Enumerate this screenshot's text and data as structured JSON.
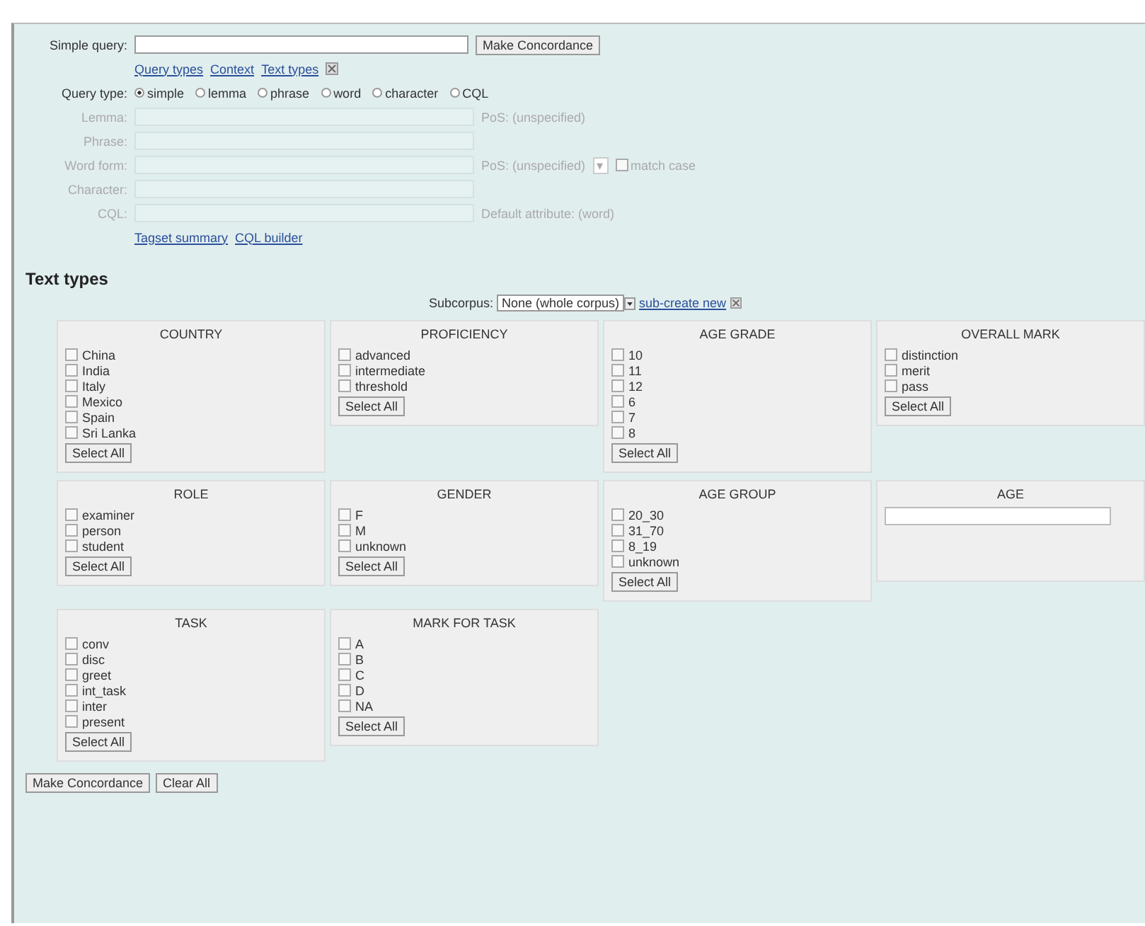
{
  "query": {
    "label": "Simple query:",
    "button": "Make Concordance"
  },
  "links": [
    "Query types",
    "Context",
    "Text types"
  ],
  "query_type": {
    "label": "Query type:",
    "options": [
      {
        "label": "simple",
        "selected": true
      },
      {
        "label": "lemma",
        "selected": false
      },
      {
        "label": "phrase",
        "selected": false
      },
      {
        "label": "word",
        "selected": false
      },
      {
        "label": "character",
        "selected": false
      },
      {
        "label": "CQL",
        "selected": false
      }
    ]
  },
  "fields": [
    {
      "label": "Lemma:",
      "extra": "PoS: (unspecified)"
    },
    {
      "label": "Phrase:"
    },
    {
      "label": "Word form:",
      "extra": "PoS: (unspecified)",
      "select_value": "▾",
      "checkbox": {
        "label": "match case",
        "checked": false
      }
    },
    {
      "label": "Character:"
    },
    {
      "label": "CQL:",
      "extra": "Default attribute: (word)"
    }
  ],
  "tool_links": [
    "Tagset summary",
    "CQL builder"
  ],
  "text_types": {
    "title": "Text types",
    "subcorpus_label": "Subcorpus:",
    "subcorpus_value": "None (whole corpus)",
    "subcorpus_link": "sub-create new",
    "boxes": [
      {
        "kind": "list",
        "title": "COUNTRY",
        "items": [
          {
            "label": "China",
            "checked": false
          },
          {
            "label": "India",
            "checked": false
          },
          {
            "label": "Italy",
            "checked": false
          },
          {
            "label": "Mexico",
            "checked": false
          },
          {
            "label": "Spain",
            "checked": false
          },
          {
            "label": "Sri Lanka",
            "checked": false
          }
        ],
        "button": "Select All"
      },
      {
        "kind": "list",
        "title": "PROFICIENCY",
        "items": [
          {
            "label": "advanced",
            "checked": false
          },
          {
            "label": "intermediate",
            "checked": false
          },
          {
            "label": "threshold",
            "checked": false
          }
        ],
        "button": "Select All"
      },
      {
        "kind": "list",
        "title": "AGE GRADE",
        "items": [
          {
            "label": "10",
            "checked": false
          },
          {
            "label": "11",
            "checked": false
          },
          {
            "label": "12",
            "checked": false
          },
          {
            "label": "6",
            "checked": false
          },
          {
            "label": "7",
            "checked": false
          },
          {
            "label": "8",
            "checked": false
          }
        ],
        "button": "Select All"
      },
      {
        "kind": "list",
        "title": "OVERALL MARK",
        "items": [
          {
            "label": "distinction",
            "checked": false
          },
          {
            "label": "merit",
            "checked": false
          },
          {
            "label": "pass",
            "checked": false
          }
        ],
        "button": "Select All"
      },
      {
        "kind": "list",
        "title": "ROLE",
        "items": [
          {
            "label": "examiner",
            "checked": false
          },
          {
            "label": "person",
            "checked": false
          },
          {
            "label": "student",
            "checked": false
          }
        ],
        "button": "Select All"
      },
      {
        "kind": "list",
        "title": "GENDER",
        "items": [
          {
            "label": "F",
            "checked": false
          },
          {
            "label": "M",
            "checked": false
          },
          {
            "label": "unknown",
            "checked": false
          }
        ],
        "button": "Select All"
      },
      {
        "kind": "list",
        "title": "AGE GROUP",
        "items": [
          {
            "label": "20_30",
            "checked": false
          },
          {
            "label": "31_70",
            "checked": false
          },
          {
            "label": "8_19",
            "checked": false
          },
          {
            "label": "unknown",
            "checked": false
          }
        ],
        "button": "Select All"
      },
      {
        "kind": "input",
        "title": "AGE"
      },
      {
        "kind": "list",
        "title": "TASK",
        "items": [
          {
            "label": "conv",
            "checked": false
          },
          {
            "label": "disc",
            "checked": false
          },
          {
            "label": "greet",
            "checked": false
          },
          {
            "label": "int_task",
            "checked": false
          },
          {
            "label": "inter",
            "checked": false
          },
          {
            "label": "present",
            "checked": false
          }
        ],
        "button": "Select All"
      },
      {
        "kind": "list",
        "title": "MARK FOR TASK",
        "items": [
          {
            "label": "A",
            "checked": false
          },
          {
            "label": "B",
            "checked": false
          },
          {
            "label": "C",
            "checked": false
          },
          {
            "label": "D",
            "checked": false
          },
          {
            "label": "NA",
            "checked": false
          }
        ],
        "button": "Select All"
      }
    ]
  },
  "buttons": [
    "Make Concordance",
    "Clear All"
  ]
}
